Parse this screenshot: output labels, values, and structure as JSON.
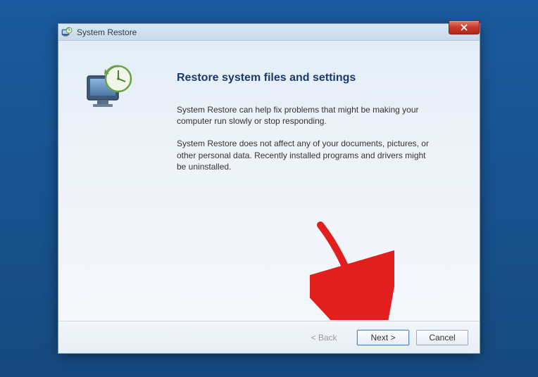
{
  "titlebar": {
    "title": "System Restore"
  },
  "content": {
    "heading": "Restore system files and settings",
    "para1": "System Restore can help fix problems that might be making your computer run slowly or stop responding.",
    "para2": "System Restore does not affect any of your documents, pictures, or other personal data. Recently installed programs and drivers might be uninstalled."
  },
  "buttons": {
    "back": "< Back",
    "next": "Next >",
    "cancel": "Cancel"
  }
}
